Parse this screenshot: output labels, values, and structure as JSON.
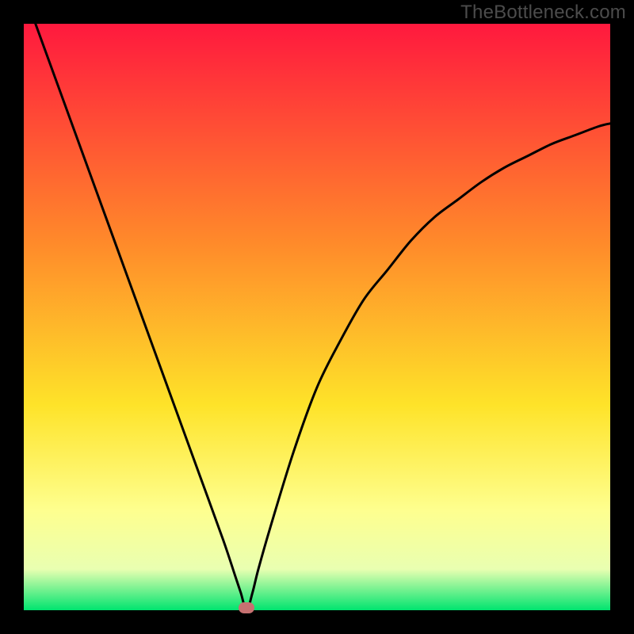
{
  "watermark": "TheBottleneck.com",
  "colors": {
    "frame": "#000000",
    "curve": "#000000",
    "marker": "#c77171",
    "gradient_top": "#ff193e",
    "gradient_mid_high": "#ff8c2a",
    "gradient_mid": "#fee329",
    "gradient_mid_low": "#feff8f",
    "gradient_low": "#e9ffb1",
    "gradient_bottom": "#00e46f"
  },
  "chart_data": {
    "type": "line",
    "title": "",
    "xlabel": "",
    "ylabel": "",
    "x_range": [
      0,
      100
    ],
    "y_range": [
      0,
      100
    ],
    "optimum_x": 38,
    "optimum_y": 0,
    "series": [
      {
        "name": "bottleneck-curve",
        "x": [
          2,
          6,
          10,
          14,
          18,
          22,
          26,
          30,
          34,
          36,
          37,
          38,
          39,
          40,
          42,
          46,
          50,
          54,
          58,
          62,
          66,
          70,
          74,
          78,
          82,
          86,
          90,
          94,
          98,
          100
        ],
        "y": [
          100,
          89,
          78,
          67,
          56,
          45,
          34,
          23,
          12,
          6,
          3,
          0,
          3,
          7,
          14,
          27,
          38,
          46,
          53,
          58,
          63,
          67,
          70,
          73,
          75.5,
          77.5,
          79.5,
          81,
          82.5,
          83
        ]
      }
    ],
    "marker": {
      "x": 38,
      "y": 0
    },
    "gradient_stops": [
      {
        "pct": 0,
        "meaning": "high-bottleneck"
      },
      {
        "pct": 50,
        "meaning": "moderate"
      },
      {
        "pct": 82,
        "meaning": "low"
      },
      {
        "pct": 100,
        "meaning": "optimal"
      }
    ]
  }
}
